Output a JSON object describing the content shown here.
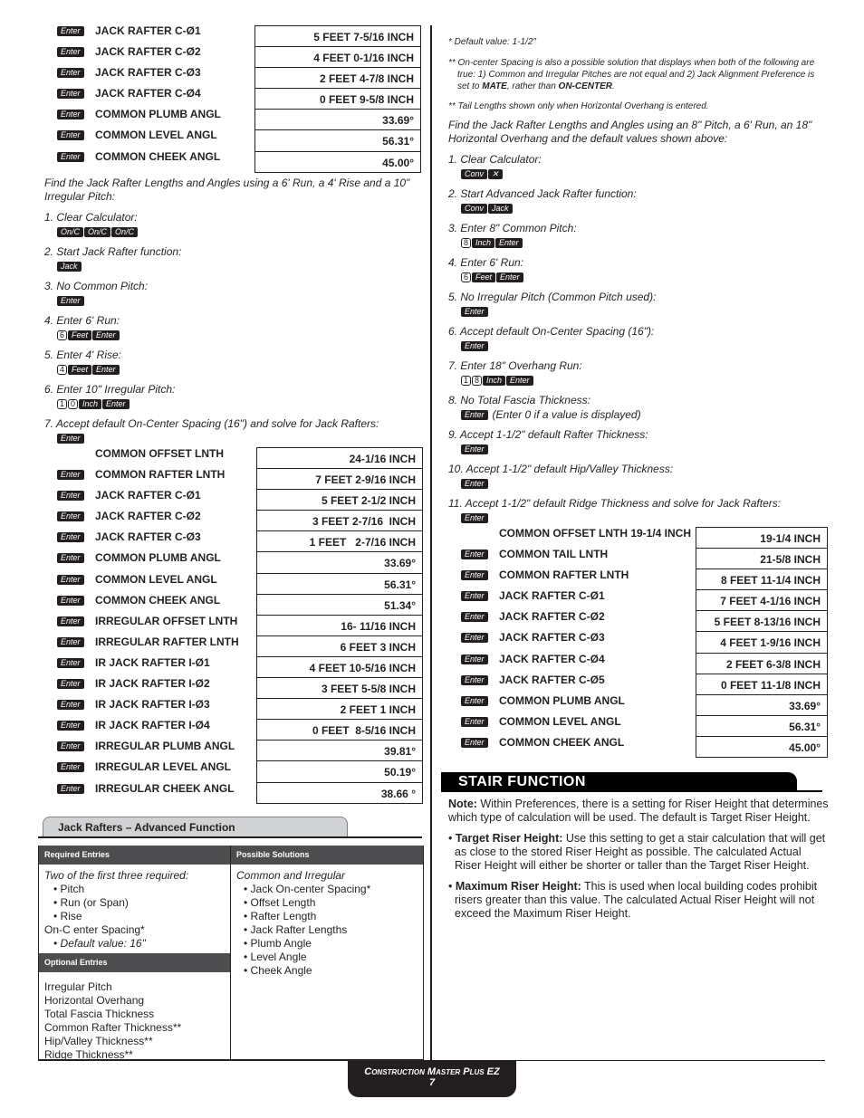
{
  "left": {
    "table1": {
      "rows": [
        {
          "key": "Enter",
          "label": "JACK RAFTER C-Ø1",
          "value": "5 FEET 7-5/16 INCH"
        },
        {
          "key": "Enter",
          "label": "JACK RAFTER C-Ø2",
          "value": "4 FEET 0-1/16 INCH"
        },
        {
          "key": "Enter",
          "label": "JACK RAFTER C-Ø3",
          "value": "2 FEET 4-7/8 INCH"
        },
        {
          "key": "Enter",
          "label": "JACK RAFTER C-Ø4",
          "value": "0 FEET 9-5/8 INCH"
        },
        {
          "key": "Enter",
          "label": "COMMON PLUMB ANGL",
          "value": "33.69°"
        },
        {
          "key": "Enter",
          "label": "COMMON LEVEL ANGL",
          "value": "56.31°"
        },
        {
          "key": "Enter",
          "label": "COMMON CHEEK ANGL",
          "value": "45.00°"
        }
      ]
    },
    "example": "Find the Jack Rafter Lengths and Angles using a 6' Run, a 4' Rise and a 10\" Irregular Pitch:",
    "steps": [
      {
        "text": "1. Clear Calculator:",
        "keys": [
          {
            "t": "On/C"
          },
          {
            "t": "On/C"
          },
          {
            "t": "On/C"
          }
        ]
      },
      {
        "text": "2. Start Jack Rafter function:",
        "keys": [
          {
            "t": "Jack"
          }
        ]
      },
      {
        "text": "3. No Common Pitch:",
        "keys": [
          {
            "t": "Enter"
          }
        ]
      },
      {
        "text": "4. Enter 6' Run:",
        "keys": [
          {
            "t": "6",
            "digit": true
          },
          {
            "t": "Feet"
          },
          {
            "t": "Enter"
          }
        ]
      },
      {
        "text": "5. Enter 4' Rise:",
        "keys": [
          {
            "t": "4",
            "digit": true
          },
          {
            "t": "Feet"
          },
          {
            "t": "Enter"
          }
        ]
      },
      {
        "text": "6. Enter 10\" Irregular Pitch:",
        "keys": [
          {
            "t": "1",
            "digit": true
          },
          {
            "t": "0",
            "digit": true
          },
          {
            "t": "Inch"
          },
          {
            "t": "Enter"
          }
        ]
      },
      {
        "text": "7. Accept default On-Center Spacing (16\") and solve for Jack Rafters:",
        "keys": [
          {
            "t": "Enter"
          }
        ]
      }
    ],
    "table2": {
      "rows": [
        {
          "key": "",
          "label": "COMMON OFFSET  LNTH",
          "value": "24-1/16 INCH"
        },
        {
          "key": "Enter",
          "label": "COMMON RAFTER LNTH",
          "value": "7 FEET 2-9/16 INCH"
        },
        {
          "key": "Enter",
          "label": "JACK RAFTER C-Ø1",
          "value": "5 FEET 2-1/2 INCH"
        },
        {
          "key": "Enter",
          "label": "JACK RAFTER C-Ø2",
          "value": "3 FEET 2-7/16  INCH"
        },
        {
          "key": "Enter",
          "label": "JACK RAFTER C-Ø3",
          "value": "1 FEET   2-7/16 INCH"
        },
        {
          "key": "Enter",
          "label": "COMMON PLUMB ANGL",
          "value": "33.69°"
        },
        {
          "key": "Enter",
          "label": "COMMON LEVEL ANGL",
          "value": "56.31°"
        },
        {
          "key": "Enter",
          "label": "COMMON CHEEK ANGL",
          "value": "51.34°"
        },
        {
          "key": "Enter",
          "label": "IRREGULAR OFFSET LNTH",
          "value": "16- 11/16 INCH"
        },
        {
          "key": "Enter",
          "label": "IRREGULAR RAFTER LNTH",
          "value": "6 FEET 3 INCH"
        },
        {
          "key": "Enter",
          "label": "IR JACK RAFTER I-Ø1",
          "value": "4 FEET 10-5/16 INCH"
        },
        {
          "key": "Enter",
          "label": "IR JACK RAFTER I-Ø2",
          "value": "3 FEET 5-5/8 INCH"
        },
        {
          "key": "Enter",
          "label": "IR JACK RAFTER I-Ø3",
          "value": "2 FEET 1 INCH"
        },
        {
          "key": "Enter",
          "label": "IR JACK RAFTER I-Ø4",
          "value": "0 FEET  8-5/16 INCH"
        },
        {
          "key": "Enter",
          "label": "IRREGULAR PLUMB ANGL",
          "value": "39.81°"
        },
        {
          "key": "Enter",
          "label": "IRREGULAR LEVEL ANGL",
          "value": "50.19°"
        },
        {
          "key": "Enter",
          "label": "IRREGULAR CHEEK ANGL",
          "value": "38.66 °"
        }
      ]
    },
    "advanced": {
      "tab_title": "Jack Rafters – Advanced Function",
      "required_header": "Required Entries",
      "required_intro": "Two of the first three required:",
      "required_items": [
        "• Pitch",
        "• Run (or Span)",
        "• Rise"
      ],
      "spacing": "On-C enter Spacing*",
      "spacing_default": "• Default value: 16\"",
      "optional_header": "Optional Entries",
      "optional_items": [
        "Irregular Pitch",
        "Horizontal Overhang",
        "Total Fascia Thickness",
        "Common Rafter Thickness**",
        "Hip/Valley Thickness**",
        "Ridge Thickness**"
      ],
      "solutions_header": "Possible Solutions",
      "solutions_intro": "Common and Irregular",
      "solutions_items": [
        "• Jack On-center Spacing*",
        "• Offset Length",
        "• Rafter Length",
        "• Jack Rafter Lengths",
        "• Plumb Angle",
        "• Level Angle",
        "• Cheek Angle"
      ]
    }
  },
  "right": {
    "footnote1": "* Default value: 1-1/2\"",
    "footnote2_a": "** On-center Spacing is also a possible solution that displays when both of the following are true: 1) Common and Irregular Pitches are not equal and 2) Jack Alignment Preference is set to ",
    "footnote2_b": "MATE",
    "footnote2_c": ", rather than ",
    "footnote2_d": "ON-CENTER",
    "footnote2_e": ".",
    "footnote3": "** Tail Lengths shown only when Horizontal Overhang is entered.",
    "example": "Find the Jack Rafter Lengths and Angles using an 8\" Pitch, a 6' Run, an 18\" Horizontal Overhang and the default values shown above:",
    "steps": [
      {
        "text": "1. Clear Calculator:",
        "keys": [
          {
            "t": "Conv"
          },
          {
            "t": "✕"
          }
        ]
      },
      {
        "text": "2. Start Advanced Jack Rafter function:",
        "keys": [
          {
            "t": "Conv"
          },
          {
            "t": "Jack"
          }
        ]
      },
      {
        "text": "3. Enter 8\" Common Pitch:",
        "keys": [
          {
            "t": "8",
            "digit": true
          },
          {
            "t": "Inch"
          },
          {
            "t": "Enter"
          }
        ]
      },
      {
        "text": "4. Enter 6' Run:",
        "keys": [
          {
            "t": "6",
            "digit": true
          },
          {
            "t": "Feet"
          },
          {
            "t": "Enter"
          }
        ]
      },
      {
        "text": "5. No Irregular Pitch (Common Pitch used):",
        "keys": [
          {
            "t": "Enter"
          }
        ]
      },
      {
        "text": "6. Accept default On-Center Spacing (16\"):",
        "keys": [
          {
            "t": "Enter"
          }
        ]
      },
      {
        "text": "7. Enter 18\" Overhang Run:",
        "keys": [
          {
            "t": "1",
            "digit": true
          },
          {
            "t": "8",
            "digit": true
          },
          {
            "t": "Inch"
          },
          {
            "t": "Enter"
          }
        ]
      },
      {
        "text": "8. No Total Fascia Thickness:",
        "keys": [
          {
            "t": "Enter"
          }
        ],
        "note": "(Enter 0 if a value is displayed)"
      },
      {
        "text": "9. Accept 1-1/2\" default Rafter Thickness:",
        "keys": [
          {
            "t": "Enter"
          }
        ]
      },
      {
        "text": "10. Accept 1-1/2\" default Hip/Valley Thickness:",
        "keys": [
          {
            "t": "Enter"
          }
        ]
      },
      {
        "text": "11. Accept 1-1/2\" default Ridge Thickness and solve for Jack Rafters:",
        "keys": [
          {
            "t": "Enter"
          }
        ]
      }
    ],
    "table": {
      "rows": [
        {
          "key": "",
          "label": "COMMON OFFSET LNTH 19-1/4 INCH",
          "value": "19-1/4 INCH"
        },
        {
          "key": "Enter",
          "label": "COMMON TAIL  LNTH",
          "value": "21-5/8 INCH"
        },
        {
          "key": "Enter",
          "label": "COMMON RAFTER LNTH",
          "value": "8 FEET 11-1/4 INCH"
        },
        {
          "key": "Enter",
          "label": "JACK RAFTER C-Ø1",
          "value": "7 FEET 4-1/16 INCH"
        },
        {
          "key": "Enter",
          "label": "JACK RAFTER C-Ø2",
          "value": "5 FEET 8-13/16 INCH"
        },
        {
          "key": "Enter",
          "label": "JACK RAFTER C-Ø3",
          "value": "4 FEET 1-9/16 INCH"
        },
        {
          "key": "Enter",
          "label": "JACK RAFTER C-Ø4",
          "value": "2 FEET 6-3/8 INCH"
        },
        {
          "key": "Enter",
          "label": "JACK RAFTER C-Ø5",
          "value": "0 FEET 11-1/8 INCH"
        },
        {
          "key": "Enter",
          "label": "COMMON PLUMB ANGL",
          "value": "33.69°"
        },
        {
          "key": "Enter",
          "label": "COMMON LEVEL ANGL",
          "value": "56.31°"
        },
        {
          "key": "Enter",
          "label": "COMMON CHEEK ANGL",
          "value": "45.00°"
        }
      ]
    },
    "stair": {
      "title": "STAIR FUNCTION",
      "note_label": "Note:",
      "note_text": " Within Preferences, there is a setting for Riser Height that determines which type of calculation will be used. The default is Target Riser Height.",
      "bullet1_label": "Target Riser Height:",
      "bullet1_text": " Use this setting to get a stair calculation that will get as close to the stored Riser Height as possible. The calculated Actual Riser Height will either be shorter or taller than the Target Riser Height.",
      "bullet2_label": "Maximum Riser Height:",
      "bullet2_text": " This is used when local building codes prohibit risers greater than this value. The calculated Actual Riser Height will not exceed the Maximum Riser Height."
    }
  },
  "footer": {
    "title": "Construction Master Plus EZ",
    "page": "7"
  }
}
